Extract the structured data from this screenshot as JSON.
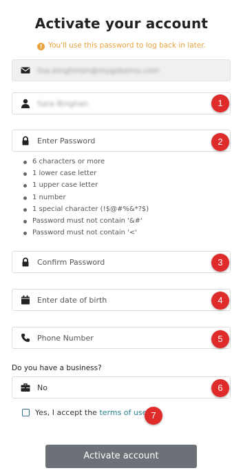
{
  "header": {
    "title": "Activate your account",
    "notice": "You'll use this password to log back in later."
  },
  "fields": {
    "email": {
      "value": "lisa.binghmen@mygobemo.com"
    },
    "name": {
      "value": "Sara Binghan"
    },
    "password": {
      "placeholder": "Enter Password"
    },
    "password_rules": [
      "6 characters or more",
      "1 lower case letter",
      "1 upper case letter",
      "1 number",
      "1 special character (!$@#%&*?$)",
      "Password must not contain '&#'",
      "Password must not contain '<'"
    ],
    "confirm_password": {
      "placeholder": "Confirm Password"
    },
    "dob": {
      "placeholder": "Enter date of birth"
    },
    "phone": {
      "placeholder": "Phone Number"
    },
    "business": {
      "question": "Do you have a business?",
      "selected": "No"
    }
  },
  "accept": {
    "prefix": "Yes, I accept the ",
    "link": "terms of use",
    "suffix": "."
  },
  "submit_label": "Activate account",
  "markers": [
    "1",
    "2",
    "3",
    "4",
    "5",
    "6",
    "7"
  ],
  "colors": {
    "title": "#222222",
    "notice": "#e8a33d",
    "marker": "#e02b2b",
    "link": "#2a7f8c",
    "button": "#6b7176"
  },
  "icons": {
    "notice": "info-icon",
    "email": "envelope-icon",
    "name": "user-icon",
    "password": "lock-icon",
    "confirm_password": "lock-icon",
    "dob": "calendar-icon",
    "phone": "phone-icon",
    "business": "briefcase-icon"
  }
}
